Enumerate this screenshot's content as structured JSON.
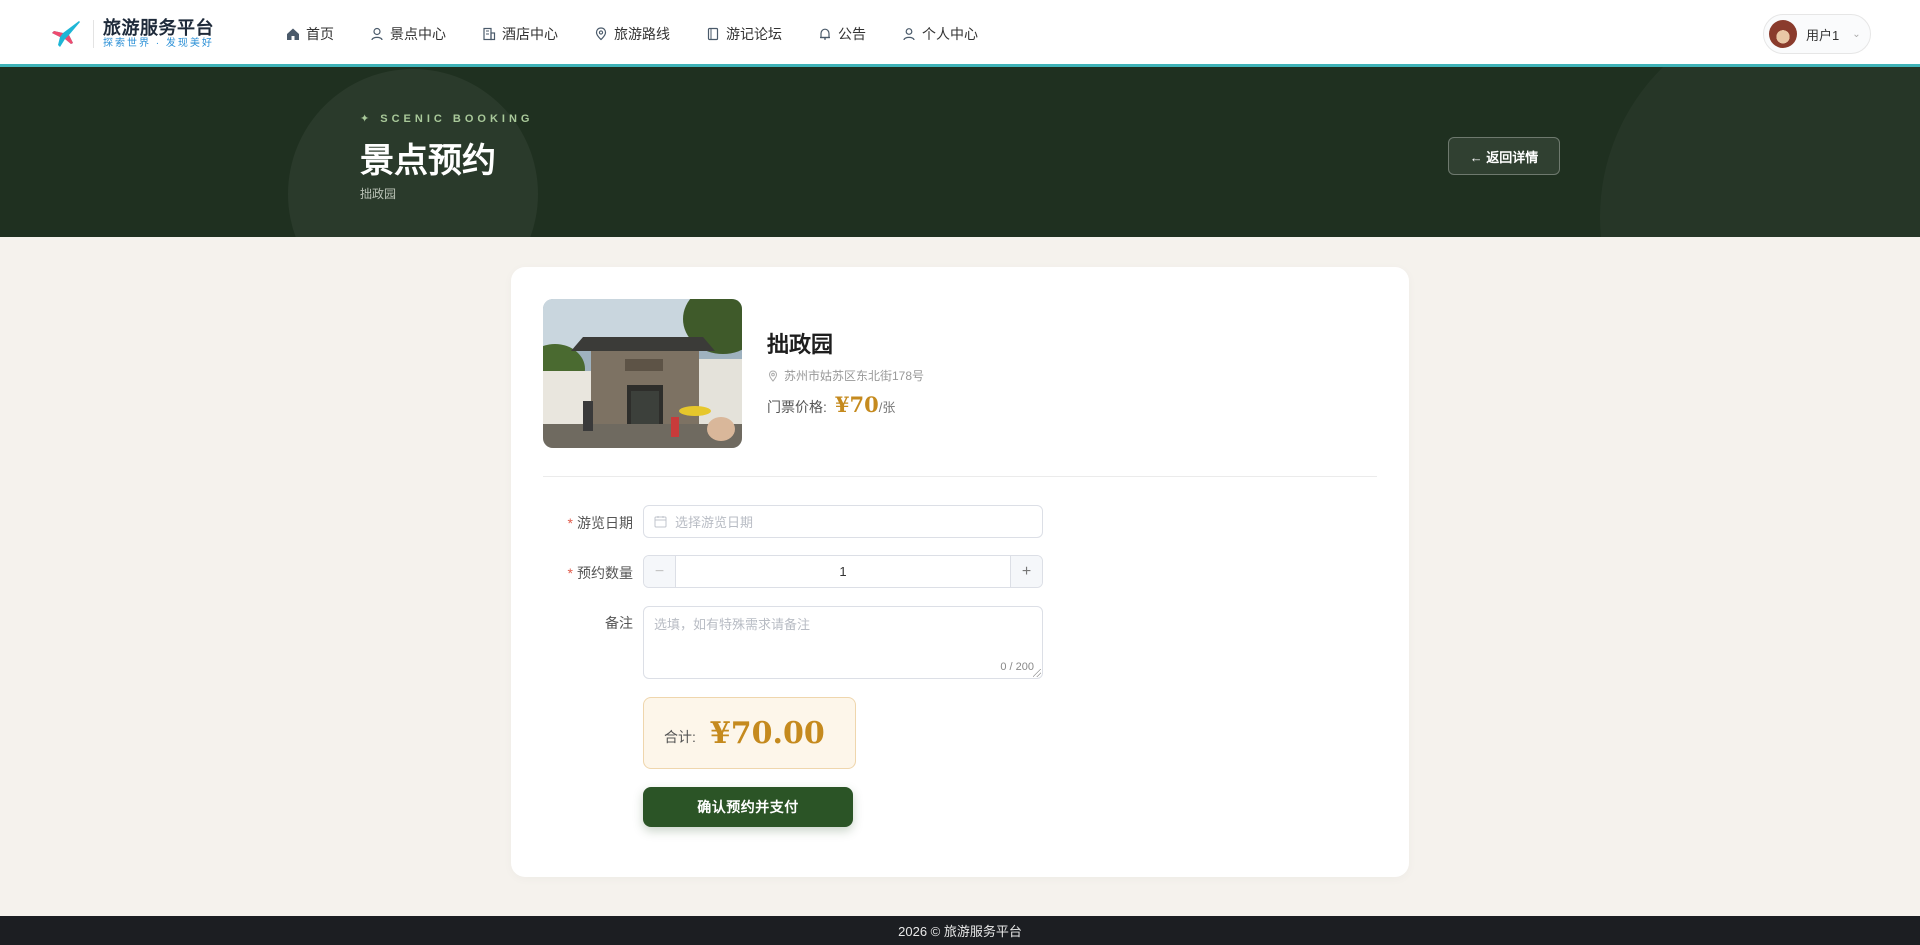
{
  "brand": {
    "name": "旅游服务平台",
    "slogan": "探索世界 · 发现美好"
  },
  "nav": {
    "items": [
      {
        "label": "首页",
        "icon": "home-icon"
      },
      {
        "label": "景点中心",
        "icon": "user-pin-icon"
      },
      {
        "label": "酒店中心",
        "icon": "building-icon"
      },
      {
        "label": "旅游路线",
        "icon": "map-pin-icon"
      },
      {
        "label": "游记论坛",
        "icon": "book-icon"
      },
      {
        "label": "公告",
        "icon": "bell-icon"
      },
      {
        "label": "个人中心",
        "icon": "user-icon"
      }
    ]
  },
  "user": {
    "name": "用户1",
    "caret": "⌄"
  },
  "hero": {
    "tag": "✦ SCENIC BOOKING",
    "title": "景点预约",
    "subtitle": "拙政园",
    "back_label": "← 返回详情"
  },
  "spot": {
    "name": "拙政园",
    "address": "苏州市姑苏区东北街178号",
    "price_label": "门票价格:",
    "price": "¥70",
    "price_unit": "/张"
  },
  "form": {
    "date_label": "游览日期",
    "date_placeholder": "选择游览日期",
    "qty_label": "预约数量",
    "qty_value": "1",
    "qty_minus": "−",
    "qty_plus": "+",
    "remark_label": "备注",
    "remark_placeholder": "选填，如有特殊需求请备注",
    "remark_count": "0 / 200",
    "required_mark": "*"
  },
  "summary": {
    "label": "合计:",
    "total": "¥70.00"
  },
  "actions": {
    "confirm_label": "确认预约并支付"
  },
  "footer": {
    "text": "2026 © 旅游服务平台"
  },
  "colors": {
    "hero_bg": "#1f3020",
    "accent_gold": "#c58a1e",
    "primary_green": "#2b5426",
    "header_line": "#3fb3b8",
    "page_bg": "#f5f2ed"
  }
}
